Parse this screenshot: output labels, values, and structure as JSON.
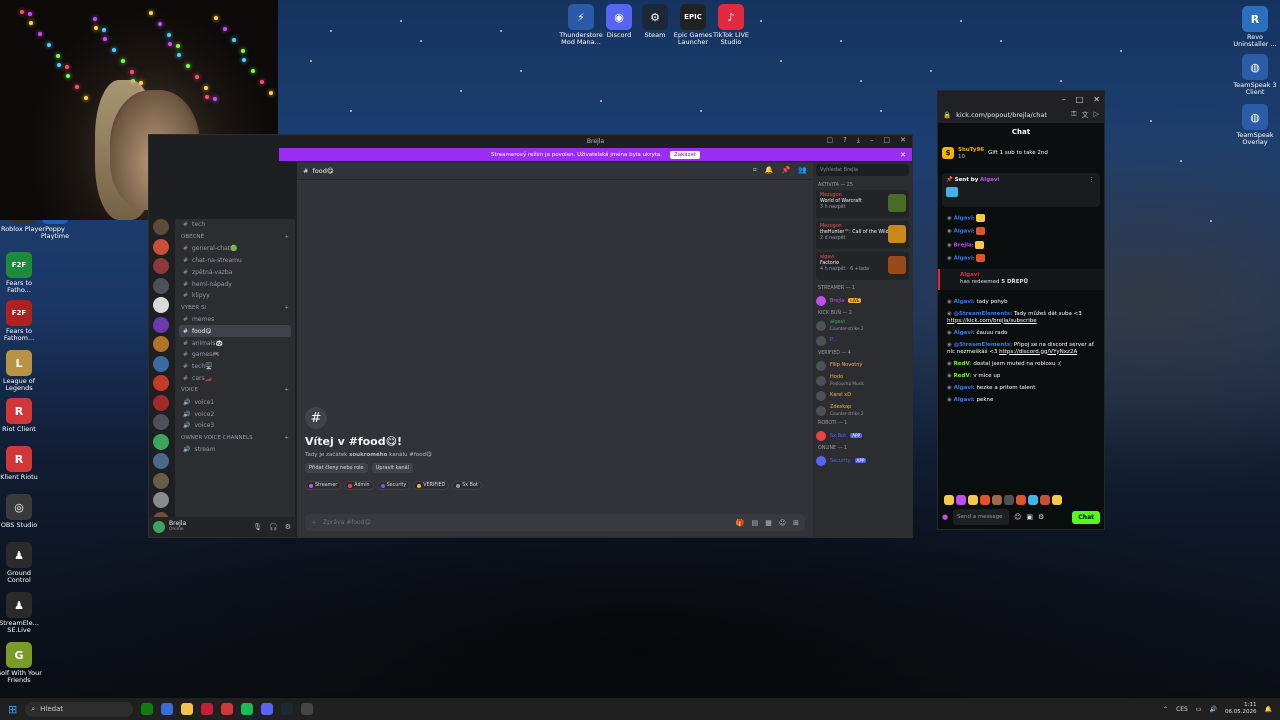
{
  "desktop": {
    "top_icons": [
      {
        "label": "Thunderstore Mod Mana...",
        "color": "#2a5aa8",
        "glyph": "⚡",
        "icon": "thunderstore-icon"
      },
      {
        "label": "Discord",
        "color": "#5865f2",
        "glyph": "◉",
        "icon": "discord-icon"
      },
      {
        "label": "Steam",
        "color": "#1b2838",
        "glyph": "⚙",
        "icon": "steam-icon"
      },
      {
        "label": "Epic Games Launcher",
        "color": "#222222",
        "glyph": "EPIC",
        "icon": "epic-games-icon"
      },
      {
        "label": "TikTok LIVE Studio",
        "color": "#e0283e",
        "glyph": "♪",
        "icon": "tiktok-icon"
      }
    ],
    "left_icons": [
      {
        "label": "Roblox Player",
        "color": "#333333",
        "glyph": "▣",
        "icon": "roblox-icon"
      },
      {
        "label": "Poppy Playtime",
        "color": "#1f5fbf",
        "glyph": "P",
        "icon": "poppy-playtime-icon"
      },
      {
        "label": "Fears to Fatho...",
        "color": "#1e8a3c",
        "glyph": "F2F",
        "icon": "fears-to-fathom-icon"
      },
      {
        "label": "Fears to Fathom...",
        "color": "#b02020",
        "glyph": "F2F",
        "icon": "fears-to-fathom-2-icon"
      },
      {
        "label": "League of Legends",
        "color": "#b89346",
        "glyph": "L",
        "icon": "league-icon"
      },
      {
        "label": "Riot Client",
        "color": "#d13639",
        "glyph": "R",
        "icon": "riot-client-icon"
      },
      {
        "label": "Klient Riotu",
        "color": "#d13639",
        "glyph": "R",
        "icon": "riot-client-cz-icon"
      },
      {
        "label": "OBS Studio",
        "color": "#3a3a3a",
        "glyph": "◎",
        "icon": "obs-icon"
      },
      {
        "label": "Ground Control",
        "color": "#2a2a2a",
        "glyph": "♟",
        "icon": "ground-control-icon"
      },
      {
        "label": "StreamEle... SE.Live",
        "color": "#2a2a2a",
        "glyph": "♟",
        "icon": "streamelements-icon"
      },
      {
        "label": "Golf With Your Friends",
        "color": "#7a9a2a",
        "glyph": "G",
        "icon": "golf-icon"
      }
    ],
    "right_icons": [
      {
        "label": "Revo Uninstaller ...",
        "color": "#2c6fbf",
        "glyph": "R",
        "icon": "revo-icon"
      },
      {
        "label": "TeamSpeak 3 Client",
        "color": "#2a5ca8",
        "glyph": "◍",
        "icon": "teamspeak-icon"
      },
      {
        "label": "TeamSpeak Overlay",
        "color": "#2a5ca8",
        "glyph": "◍",
        "icon": "teamspeak-overlay-icon"
      }
    ]
  },
  "discord": {
    "window_title": "Brejla",
    "banner_text": "Streamerový režim je povolen. Uživatelská jména byla ukryta.",
    "banner_button": "Zakázat",
    "channels": {
      "top_channel": "tech",
      "cat_general": "OBECNÉ",
      "general": [
        "general-chat🟢",
        "chat-na-streamu",
        "zpětná-vazba",
        "herní-nápady",
        "klipyy"
      ],
      "cat_rest": "VYBER SI",
      "rest": [
        "memes",
        "food😋",
        "animals🐼",
        "games🎮",
        "tech🖥️",
        "cars🏎️"
      ],
      "cat_voice": "VOICE",
      "voice": [
        "voice1",
        "voice2",
        "voice3"
      ],
      "cat_owner": "OWNER VOICE CHANNELS",
      "owner": [
        "stream"
      ]
    },
    "server_new_badge": "NOVÉ",
    "user": {
      "name": "Brejla",
      "status": "Online"
    },
    "header_channel": "food😋",
    "welcome": {
      "title": "Vítej v #food😋!",
      "subtitle_pre": "Tady je začátek ",
      "subtitle_bold": "soukromého",
      "subtitle_post": " kanálu #food😋",
      "btn_add": "Přidat členy nebo role",
      "btn_edit": "Upravit kanál",
      "roles": [
        {
          "name": "Streamer",
          "color": "#b05cff"
        },
        {
          "name": "Admin",
          "color": "#ff4040"
        },
        {
          "name": "Security",
          "color": "#5865f2"
        },
        {
          "name": "VERIFIED",
          "color": "#f0b232"
        },
        {
          "name": "Sx Bot",
          "color": "#949ba4"
        }
      ]
    },
    "input_placeholder": "Zpráva #food😋",
    "members": {
      "search": "Vyhledat Brejla",
      "activity_label": "Aktivita — 25",
      "activities": [
        {
          "name": "Mezugon",
          "game": "World of Warcraft",
          "time": "3 h nazpět",
          "color": "#4a6a2a"
        },
        {
          "name": "Mezugon",
          "game": "theHunter™: Call of the Wild",
          "time": "2 d nazpět",
          "color": "#c98a1a"
        },
        {
          "name": "algavi",
          "game": "Factorio",
          "time": "4 h nazpět · 6 +lada",
          "color": "#9a4a1a"
        }
      ],
      "streamer_label": "Streamer — 1",
      "streamer": {
        "name": "Brejla",
        "badge": "LIVE"
      },
      "kick_label": "KICK BUŇ — 2",
      "kick": [
        {
          "name": "algavi",
          "status": "Counter-strike 2",
          "color": "#3ba55d"
        },
        {
          "name": "P...",
          "status": "",
          "color": "#5865f2"
        }
      ],
      "verified_label": "VERIFIED — 4",
      "verified": [
        {
          "name": "Filip Novotný",
          "status": "",
          "color": "#f0b232"
        },
        {
          "name": "Hodo",
          "status": "Poslouchá Music",
          "color": "#f0b232"
        },
        {
          "name": "Karel xD",
          "status": "",
          "color": "#f0b232"
        },
        {
          "name": "Zdeskap",
          "status": "Counter-strike 2",
          "color": "#f0b232"
        }
      ],
      "bots_label": "Roboti — 1",
      "bot": {
        "name": "Sx Bot",
        "tag": "APP"
      },
      "online_label": "Online — 1",
      "online": {
        "name": "Security",
        "tag": "APP"
      }
    }
  },
  "kick": {
    "url": "kick.com/popout/brejla/chat",
    "title": "Chat",
    "gift": {
      "user": "ShuTy96",
      "count": "10",
      "text": "Gift 1 sub to take 2nd"
    },
    "pinned": {
      "prefix": "Sent by",
      "user": "Algavi"
    },
    "messages": [
      {
        "user": "Algavi",
        "color": "#2f7cf6",
        "text": "",
        "emote": "#f7c948"
      },
      {
        "user": "Algavi",
        "color": "#2f7cf6",
        "text": "",
        "emote": "#e0542a"
      },
      {
        "user": "Brejla",
        "color": "#c14df2",
        "text": "",
        "emote": "#f7c948"
      },
      {
        "user": "Algavi",
        "color": "#2f7cf6",
        "text": "",
        "emote": "#e0542a"
      }
    ],
    "redeem": {
      "user": "Algavi",
      "text": "has redeemed",
      "bold": "5 DŘEPŮ"
    },
    "messages2": [
      {
        "user": "Algavi",
        "color": "#2f7cf6",
        "text": "tady pohyb"
      },
      {
        "user": "@StreamElements",
        "color": "#2f7cf6",
        "text": "Tady můžeš dát suba <3 ",
        "link": "https://kick.com/brejla/subscribe"
      },
      {
        "user": "Algavi",
        "color": "#2f7cf6",
        "text": "čauuu rado"
      },
      {
        "user": "@StreamElements",
        "color": "#2f7cf6",
        "text": "Připoj se na discord server ať nic nezmeškáš <3 ",
        "link": "https://discord.gg/VYyNxz2A"
      },
      {
        "user": "RedV",
        "color": "#53fc18",
        "text": "dostal jsem muted na robloxu :("
      },
      {
        "user": "RedV",
        "color": "#53fc18",
        "text": "v mice up"
      },
      {
        "user": "Algavi",
        "color": "#2f7cf6",
        "text": "hezke a pritom talent"
      },
      {
        "user": "Algavi",
        "color": "#2f7cf6",
        "text": "pekne"
      }
    ],
    "input_placeholder": "Send a message",
    "chat_button": "Chat"
  },
  "taskbar": {
    "search_placeholder": "Hledat",
    "lang": "CES",
    "time": "1:11",
    "date": "06.05.2026"
  }
}
